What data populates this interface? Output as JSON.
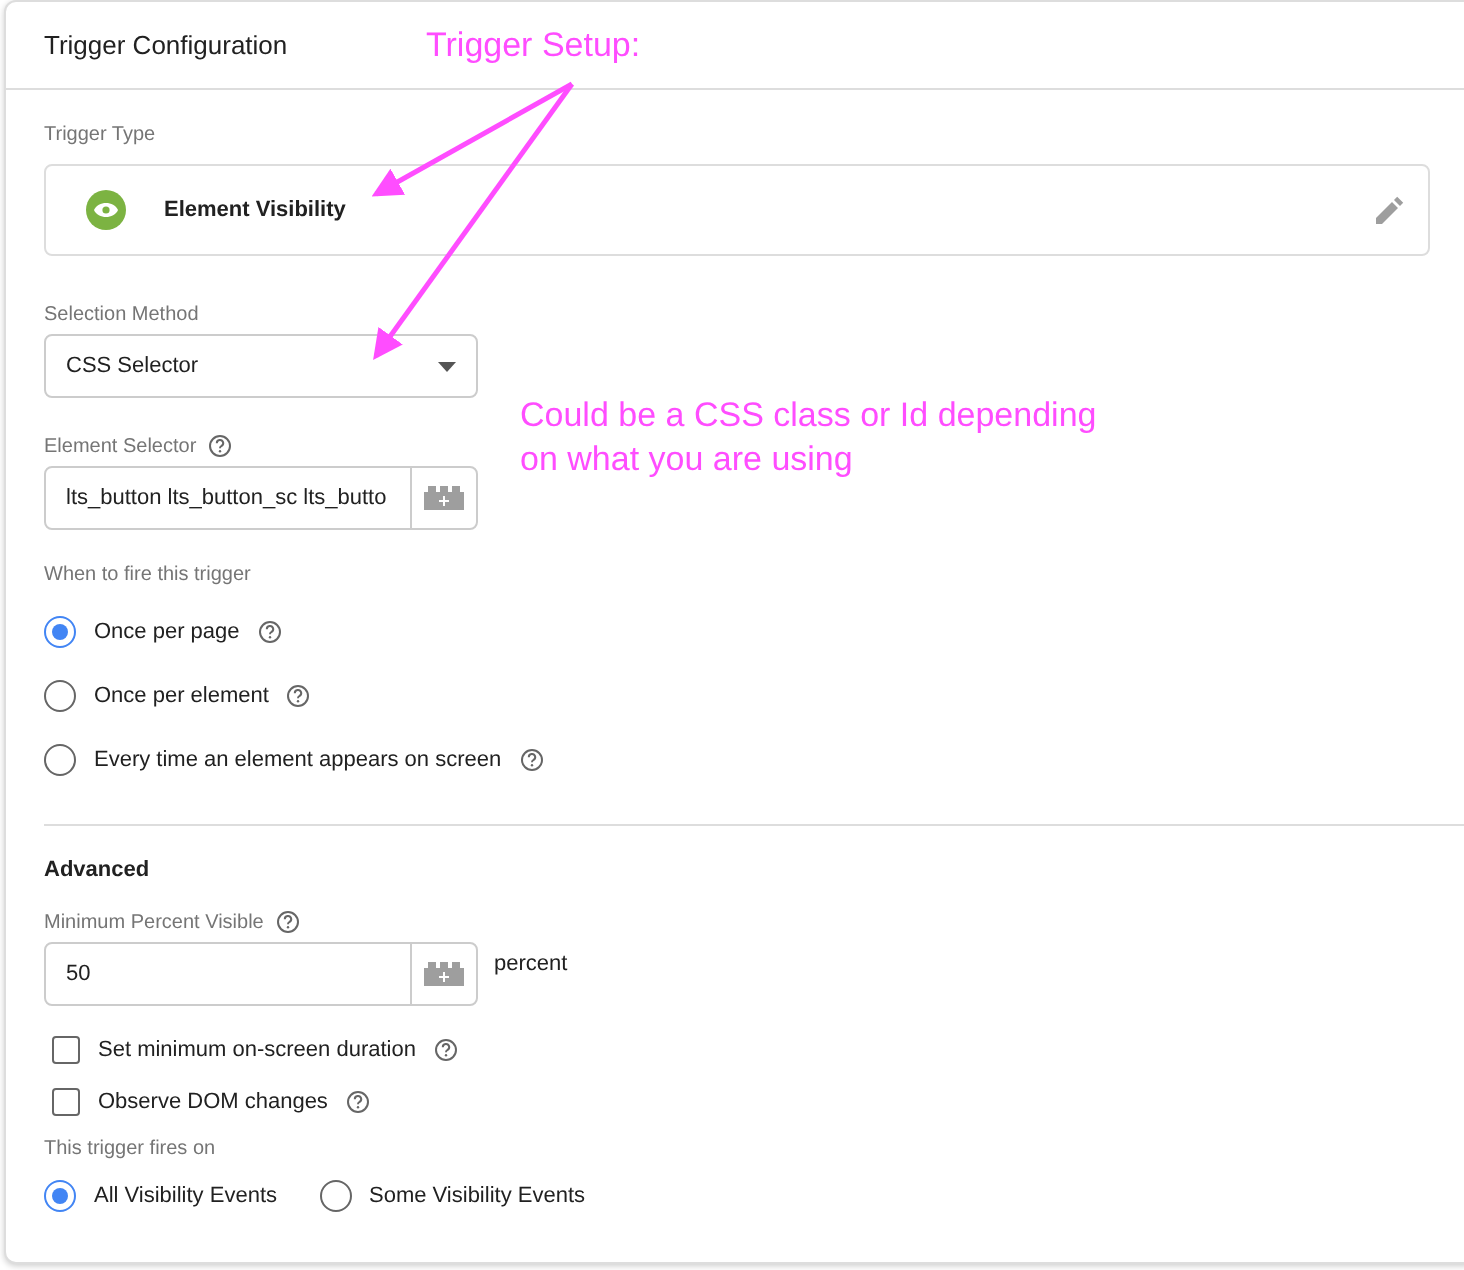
{
  "panel": {
    "title": "Trigger Configuration"
  },
  "trigger_type": {
    "label": "Trigger Type",
    "value": "Element Visibility"
  },
  "selection_method": {
    "label": "Selection Method",
    "value": "CSS Selector"
  },
  "element_selector": {
    "label": "Element Selector",
    "value": "lts_button lts_button_sc lts_butto"
  },
  "fire": {
    "label": "When to fire this trigger",
    "options": [
      {
        "label": "Once per page",
        "selected": true
      },
      {
        "label": "Once per element",
        "selected": false
      },
      {
        "label": "Every time an element appears on screen",
        "selected": false
      }
    ]
  },
  "advanced": {
    "title": "Advanced",
    "min_percent": {
      "label": "Minimum Percent Visible",
      "value": "50",
      "unit": "percent"
    },
    "checkboxes": [
      {
        "label": "Set minimum on-screen duration",
        "checked": false
      },
      {
        "label": "Observe DOM changes",
        "checked": false
      }
    ],
    "fires_on": {
      "label": "This trigger fires on",
      "options": [
        {
          "label": "All Visibility Events",
          "selected": true
        },
        {
          "label": "Some Visibility Events",
          "selected": false
        }
      ]
    }
  },
  "annotations": [
    {
      "text": "Trigger Setup:"
    },
    {
      "text": "Could be a CSS class or Id depending on what you are using"
    }
  ]
}
